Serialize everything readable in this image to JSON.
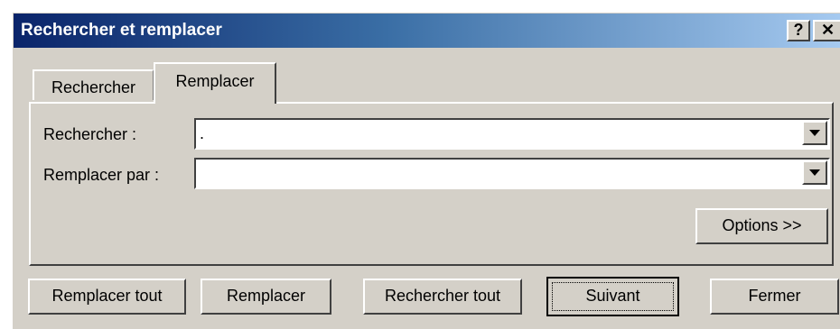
{
  "window": {
    "title": "Rechercher et remplacer"
  },
  "titlebar_buttons": {
    "help": "?",
    "close": "✕"
  },
  "tabs": [
    {
      "label": "Rechercher",
      "selected": false
    },
    {
      "label": "Remplacer",
      "selected": true
    }
  ],
  "fields": {
    "find_label": "Rechercher :",
    "find_value": ".",
    "replace_label": "Remplacer par :",
    "replace_value": ""
  },
  "buttons": {
    "options": "Options >>",
    "replace_all": "Remplacer tout",
    "replace": "Remplacer",
    "find_all": "Rechercher tout",
    "next": "Suivant",
    "close": "Fermer"
  },
  "colors": {
    "titlebar_start": "#0a246a",
    "titlebar_end": "#a6caf0",
    "dialog_face": "#d4d0c8"
  }
}
